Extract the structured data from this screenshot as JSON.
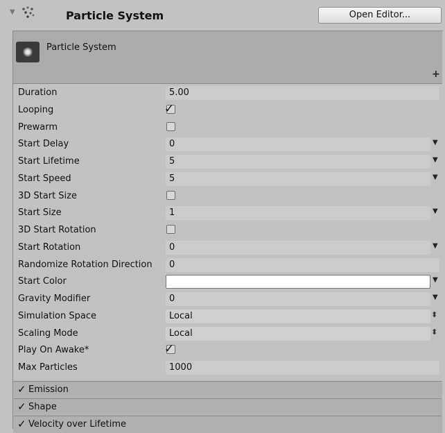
{
  "component": {
    "title": "Particle System",
    "fold_icon": "▼",
    "component_icon": "particle-system-icon",
    "help_icon": "?",
    "gear_icon": "✲",
    "open_editor_label": "Open Editor..."
  },
  "main_module": {
    "title": "Particle System",
    "add_icon": "+"
  },
  "properties": [
    {
      "label": "Duration",
      "type": "float",
      "value": "5.00"
    },
    {
      "label": "Looping",
      "type": "checkbox",
      "checked": true
    },
    {
      "label": "Prewarm",
      "type": "checkbox",
      "checked": false
    },
    {
      "label": "Start Delay",
      "type": "curve",
      "value": "0"
    },
    {
      "label": "Start Lifetime",
      "type": "curve",
      "value": "5"
    },
    {
      "label": "Start Speed",
      "type": "curve",
      "value": "5"
    },
    {
      "label": "3D Start Size",
      "type": "checkbox",
      "checked": false
    },
    {
      "label": "Start Size",
      "type": "curve",
      "value": "1"
    },
    {
      "label": "3D Start Rotation",
      "type": "checkbox",
      "checked": false
    },
    {
      "label": "Start Rotation",
      "type": "curve",
      "value": "0"
    },
    {
      "label": "Randomize Rotation Direction",
      "type": "float",
      "value": "0"
    },
    {
      "label": "Start Color",
      "type": "color",
      "value": "#ffffff"
    },
    {
      "label": "Gravity Modifier",
      "type": "curve",
      "value": "0"
    },
    {
      "label": "Simulation Space",
      "type": "popup",
      "value": "Local"
    },
    {
      "label": "Scaling Mode",
      "type": "popup",
      "value": "Local"
    },
    {
      "label": "Play On Awake*",
      "type": "checkbox",
      "checked": true
    },
    {
      "label": "Max Particles",
      "type": "int",
      "value": "1000"
    }
  ],
  "modules": [
    {
      "label": "Emission",
      "enabled": true
    },
    {
      "label": "Shape",
      "enabled": true
    },
    {
      "label": "Velocity over Lifetime",
      "enabled": true
    }
  ],
  "glyphs": {
    "check": "✓",
    "dropdown_arrow": "▼",
    "updown": "⬍"
  }
}
